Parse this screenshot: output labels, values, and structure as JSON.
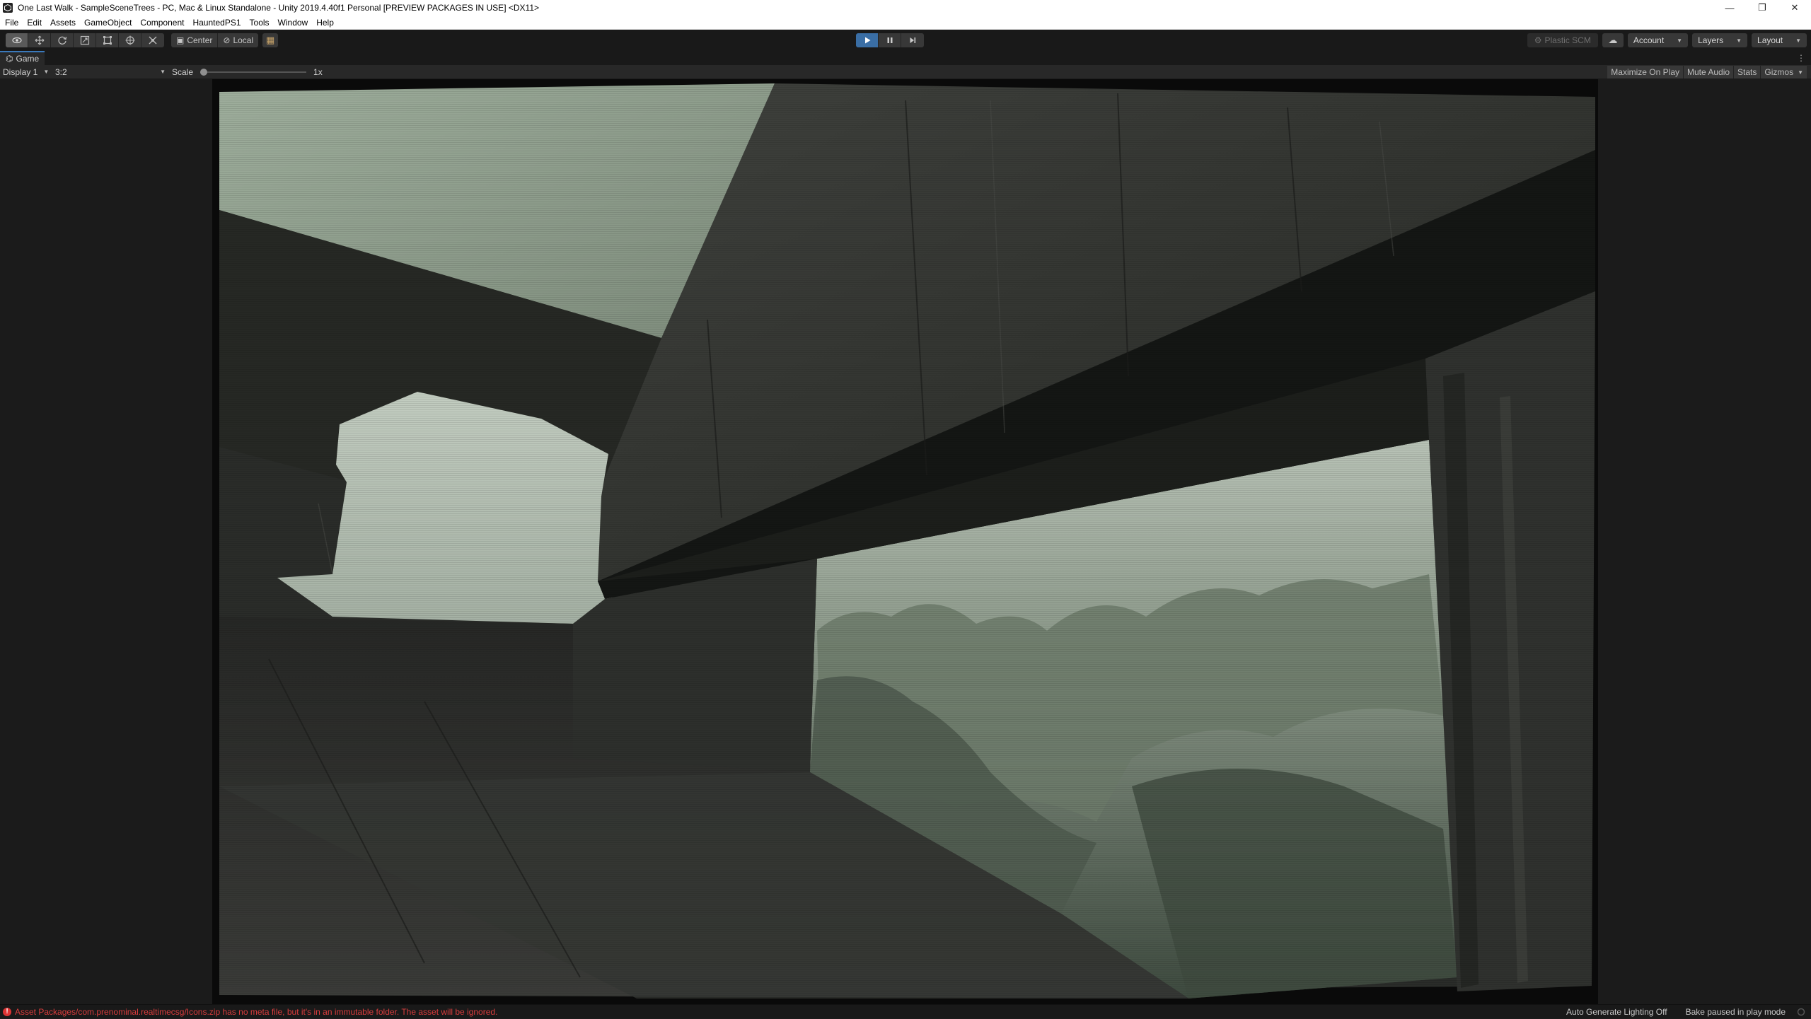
{
  "window": {
    "title": "One Last Walk - SampleSceneTrees - PC, Mac & Linux Standalone - Unity 2019.4.40f1 Personal [PREVIEW PACKAGES IN USE] <DX11>",
    "controls": [
      "—",
      "❐",
      "✕"
    ]
  },
  "menu": [
    "File",
    "Edit",
    "Assets",
    "GameObject",
    "Component",
    "HauntedPS1",
    "Tools",
    "Window",
    "Help"
  ],
  "toolbar": {
    "tools": [
      "view-tool-icon",
      "move-tool-icon",
      "rotate-tool-icon",
      "scale-tool-icon",
      "rect-tool-icon",
      "transform-tool-icon",
      "custom-tool-icon"
    ],
    "pivot_mode": "Center",
    "pivot_rotation": "Local",
    "plastic_scm": "Plastic SCM",
    "account": "Account",
    "layers": "Layers",
    "layout": "Layout",
    "playing": true
  },
  "tab": {
    "label": "Game"
  },
  "gameview": {
    "display": "Display 1",
    "aspect": "3:2",
    "scale_label": "Scale",
    "scale_value": "1x",
    "scale_level": 0.0,
    "maximize_on_play": "Maximize On Play",
    "mute_audio": "Mute Audio",
    "stats": "Stats",
    "gizmos": "Gizmos"
  },
  "status": {
    "error_message": "Asset Packages/com.prenominal.realtimecsg/Icons.zip has no meta file, but it's in an immutable folder. The asset will be ignored.",
    "lighting": "Auto Generate Lighting Off",
    "bake": "Bake paused in play mode"
  },
  "colors": {
    "accent": "#3a6ea5",
    "error": "#d93d3d",
    "sky": "#a4b3a3",
    "concrete": "#2e302d"
  }
}
